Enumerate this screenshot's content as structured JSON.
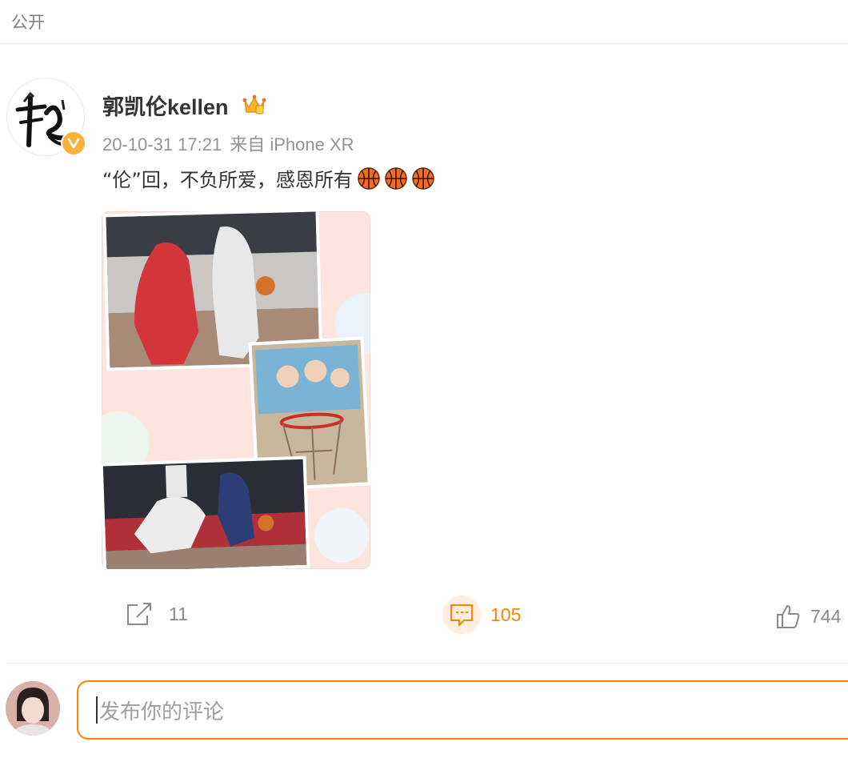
{
  "post": {
    "visibility": "公开",
    "author": {
      "name": "郭凯伦kellen",
      "verified_icon": "verified-v-icon",
      "badge_icon": "crown-icon"
    },
    "meta": {
      "time": "20-10-31 17:21",
      "source": "来自 iPhone XR"
    },
    "text": "“伦”回，不负所爱，感恩所有",
    "emojis": [
      "basketball-icon",
      "basketball-icon",
      "basketball-icon"
    ],
    "image_alt": "basketball photo collage",
    "actions": {
      "repost_count": "11",
      "comment_count": "105",
      "like_count": "744"
    }
  },
  "composer": {
    "placeholder": "发布你的评论"
  },
  "colors": {
    "accent": "#ff8200",
    "muted": "#939393",
    "text": "#333333"
  }
}
